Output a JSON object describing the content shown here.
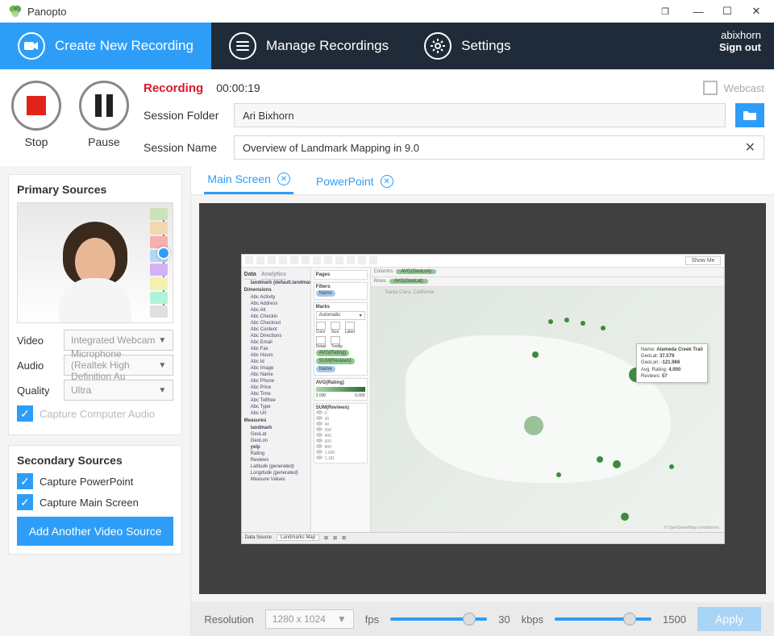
{
  "app_title": "Panopto",
  "window_controls": {
    "restore_down": "❐",
    "minimize": "—",
    "maximize": "☐",
    "close": "✕"
  },
  "account": {
    "username": "abixhorn",
    "signout": "Sign out"
  },
  "nav": {
    "create": "Create New Recording",
    "manage": "Manage Recordings",
    "settings": "Settings"
  },
  "recording": {
    "stop": "Stop",
    "pause": "Pause",
    "status": "Recording",
    "timer": "00:00:19",
    "webcast": "Webcast",
    "folder_label": "Session Folder",
    "folder_value": "Ari Bixhorn",
    "name_label": "Session Name",
    "name_value": "Overview of Landmark Mapping in 9.0"
  },
  "primary": {
    "title": "Primary Sources",
    "video_label": "Video",
    "video_value": "Integrated Webcam",
    "audio_label": "Audio",
    "audio_value": "Microphone (Realtek High Definition Au",
    "quality_label": "Quality",
    "quality_value": "Ultra",
    "capture_audio": "Capture Computer Audio"
  },
  "secondary": {
    "title": "Secondary Sources",
    "ppt": "Capture PowerPoint",
    "main": "Capture Main Screen",
    "add": "Add Another Video Source"
  },
  "tabs": {
    "main": "Main Screen",
    "ppt": "PowerPoint"
  },
  "tableau": {
    "showme": "Show Me",
    "data_tab": "Data",
    "analytics_tab": "Analytics",
    "datasource": "landmark (default.landmark)",
    "dimensions": "Dimensions",
    "dim_items": [
      "Activity",
      "Address",
      "Alt",
      "Checkin",
      "Checkout",
      "Content",
      "Directions",
      "Email",
      "Fax",
      "Hours",
      "Id",
      "Image",
      "Name",
      "Phone",
      "Price",
      "Time",
      "Tollfree",
      "Type",
      "Url"
    ],
    "measures": "Measures",
    "meas_landmark": "landmark",
    "meas_geolat": "GeoLat",
    "meas_geolon": "GeoLon",
    "meas_yelp": "yelp",
    "meas_rating": "Rating",
    "meas_reviews": "Reviews",
    "meas_lat": "Latitude (generated)",
    "meas_lon": "Longitude (generated)",
    "meas_mv": "Measure Values",
    "pages": "Pages",
    "filters": "Filters",
    "filter_name": "Name",
    "marks": "Marks",
    "marks_auto": "Automatic",
    "color": "Color",
    "size": "Size",
    "label": "Label",
    "detail": "Detail",
    "tooltip": "Tooltip",
    "pill_avg": "AVG(Rating)",
    "pill_sum": "SUM(Reviews)",
    "pill_name": "Name",
    "agg_rating": "AVG(Rating)",
    "agg_lo": "3.000",
    "agg_hi": "5.000",
    "agg_sum": "SUM(Reviews)",
    "agg_vals": [
      "0",
      "30",
      "40",
      "200",
      "400",
      "600",
      "800",
      "1,000",
      "1,181"
    ],
    "columns": "Columns",
    "rows": "Rows",
    "col_pill": "AVG(GeoLon)",
    "row_pill": "AVG(GeoLat)",
    "search": "Santa Clara, California",
    "tooltip_name": "Name",
    "tooltip_name_v": "Alameda Creek Trail",
    "tooltip_lon": "GeoLon",
    "tooltip_lon_v": "-121.966",
    "tooltip_lat": "GeoLat",
    "tooltip_lat_v": "37.579",
    "tooltip_rating": "Avg. Rating",
    "tooltip_rating_v": "4.000",
    "tooltip_rev": "Reviews",
    "tooltip_rev_v": "57",
    "osm": "© OpenStreetMap contributors",
    "sheet_ds": "Data Source",
    "sheet_map": "Landmarks Map"
  },
  "footer": {
    "resolution_label": "Resolution",
    "resolution_value": "1280 x 1024",
    "fps_label": "fps",
    "fps_value": "30",
    "kbps_label": "kbps",
    "kbps_value": "1500",
    "apply": "Apply"
  }
}
